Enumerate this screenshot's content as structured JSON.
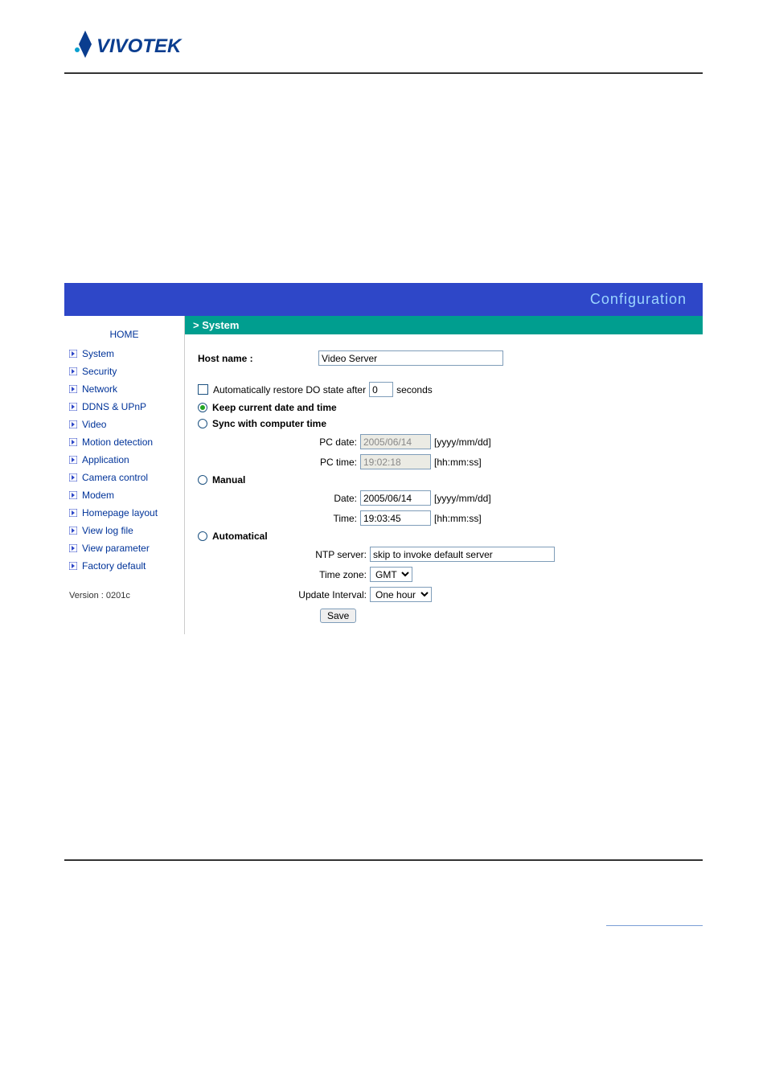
{
  "header": {
    "brand": "VIVOTEK",
    "config_label": "Configuration"
  },
  "sidebar": {
    "home_label": "HOME",
    "items": [
      {
        "label": "System",
        "name": "menu-system"
      },
      {
        "label": "Security",
        "name": "menu-security"
      },
      {
        "label": "Network",
        "name": "menu-network"
      },
      {
        "label": "DDNS & UPnP",
        "name": "menu-ddns-upnp"
      },
      {
        "label": "Video",
        "name": "menu-video"
      },
      {
        "label": "Motion detection",
        "name": "menu-motion-detection"
      },
      {
        "label": "Application",
        "name": "menu-application"
      },
      {
        "label": "Camera control",
        "name": "menu-camera-control"
      },
      {
        "label": "Modem",
        "name": "menu-modem"
      },
      {
        "label": "Homepage layout",
        "name": "menu-homepage-layout"
      },
      {
        "label": "View log file",
        "name": "menu-view-log"
      },
      {
        "label": "View parameter",
        "name": "menu-view-parameter"
      },
      {
        "label": "Factory default",
        "name": "menu-factory-default"
      }
    ],
    "version_label": "Version : 0201c"
  },
  "content": {
    "section_title": "> System",
    "hostname_label": "Host name :",
    "hostname_value": "Video Server",
    "auto_restore_prefix": "Automatically restore DO state after",
    "auto_restore_value": "0",
    "auto_restore_suffix": "seconds",
    "radio_keep": "Keep current date and time",
    "radio_sync": "Sync with computer time",
    "pc_date_label": "PC date:",
    "pc_date_value": "2005/06/14",
    "date_format_hint": "[yyyy/mm/dd]",
    "pc_time_label": "PC time:",
    "pc_time_value": "19:02:18",
    "time_format_hint": "[hh:mm:ss]",
    "radio_manual": "Manual",
    "manual_date_label": "Date:",
    "manual_date_value": "2005/06/14",
    "manual_time_label": "Time:",
    "manual_time_value": "19:03:45",
    "radio_auto": "Automatical",
    "ntp_label": "NTP server:",
    "ntp_value": "skip to invoke default server",
    "tz_label": "Time zone:",
    "tz_value": "GMT",
    "update_interval_label": "Update Interval:",
    "update_interval_value": "One hour",
    "save_label": "Save"
  }
}
